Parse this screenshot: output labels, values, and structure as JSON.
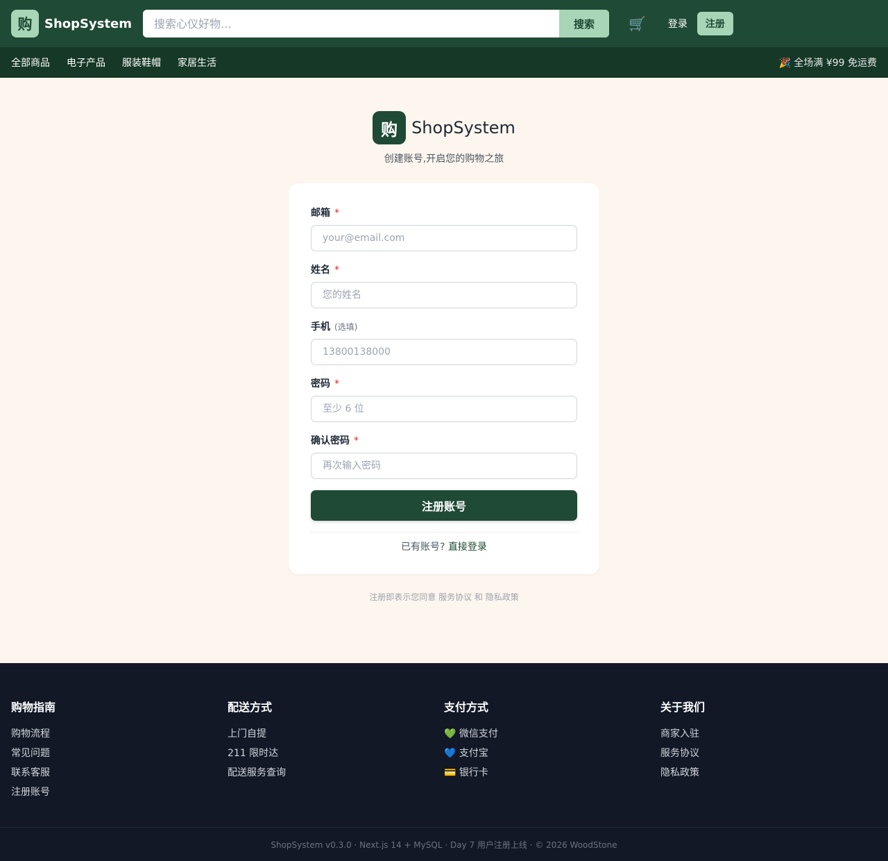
{
  "header": {
    "logo_char": "购",
    "brand": "ShopSystem",
    "search_placeholder": "搜索心仪好物...",
    "search_button": "搜索",
    "cart_icon": "🛒",
    "login": "登录",
    "register": "注册"
  },
  "nav": {
    "items": [
      "全部商品",
      "电子产品",
      "服装鞋帽",
      "家居生活"
    ],
    "promo": "🎉 全场满 ¥99 免运费"
  },
  "form": {
    "logo_char": "购",
    "brand": "ShopSystem",
    "subtitle": "创建账号,开启您的购物之旅",
    "email_label": "邮箱",
    "email_placeholder": "your@email.com",
    "name_label": "姓名",
    "name_placeholder": "您的姓名",
    "phone_label": "手机",
    "phone_optional": "(选填)",
    "phone_placeholder": "13800138000",
    "password_label": "密码",
    "password_placeholder": "至少 6 位",
    "confirm_label": "确认密码",
    "confirm_placeholder": "再次输入密码",
    "required_mark": "*",
    "submit": "注册账号",
    "have_account": "已有账号?",
    "login_link": "直接登录",
    "agree_prefix": "注册即表示您同意",
    "terms": "服务协议",
    "and": "和",
    "privacy": "隐私政策"
  },
  "footer": {
    "columns": [
      {
        "title": "购物指南",
        "links": [
          "购物流程",
          "常见问题",
          "联系客服",
          "注册账号"
        ]
      },
      {
        "title": "配送方式",
        "links": [
          "上门自提",
          "211 限时达",
          "配送服务查询"
        ]
      },
      {
        "title": "支付方式",
        "links": [
          "💚 微信支付",
          "💙 支付宝",
          "💳 银行卡"
        ]
      },
      {
        "title": "关于我们",
        "links": [
          "商家入驻",
          "服务协议",
          "隐私政策"
        ]
      }
    ],
    "bottom": "ShopSystem v0.3.0 · Next.js 14 + MySQL · Day 7 用户注册上线 · © 2026 WoodStone"
  }
}
